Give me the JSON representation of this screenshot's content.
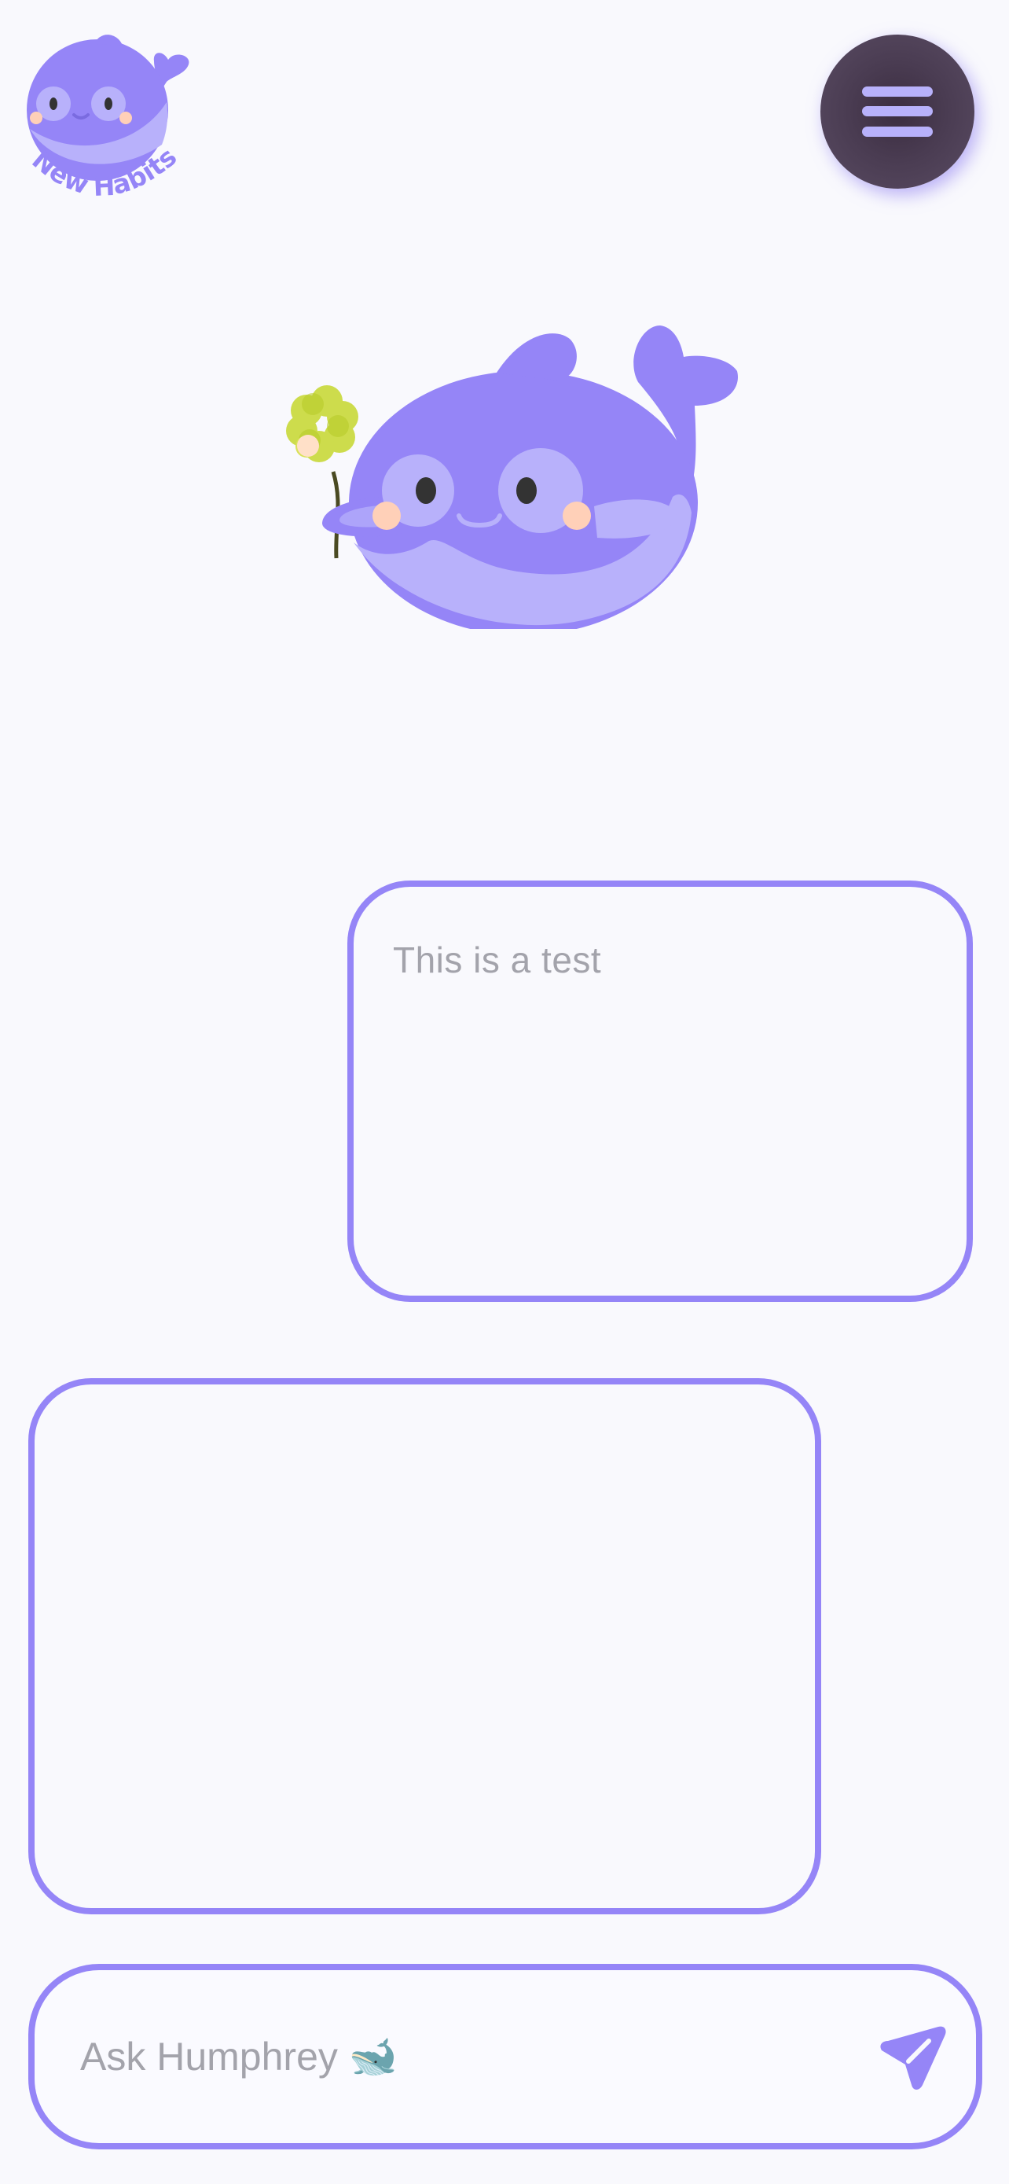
{
  "header": {
    "logo_text": "New Habits",
    "logo_icon": "whale-logo",
    "menu_icon": "hamburger-menu-icon"
  },
  "mascot": {
    "name": "Humphrey",
    "icon": "whale-holding-flower"
  },
  "chat": {
    "messages": [
      {
        "sender": "user",
        "text": "This is a test"
      },
      {
        "sender": "assistant",
        "text": ""
      }
    ]
  },
  "composer": {
    "placeholder": "Ask Humphrey 🐋",
    "value": "",
    "send_icon": "send-arrow-icon"
  },
  "colors": {
    "accent": "#9585f7",
    "accent_light": "#b8b1fb",
    "background": "#f9f9fd",
    "menu_button": "#4a3c52",
    "placeholder_text": "#a3a3ab"
  }
}
